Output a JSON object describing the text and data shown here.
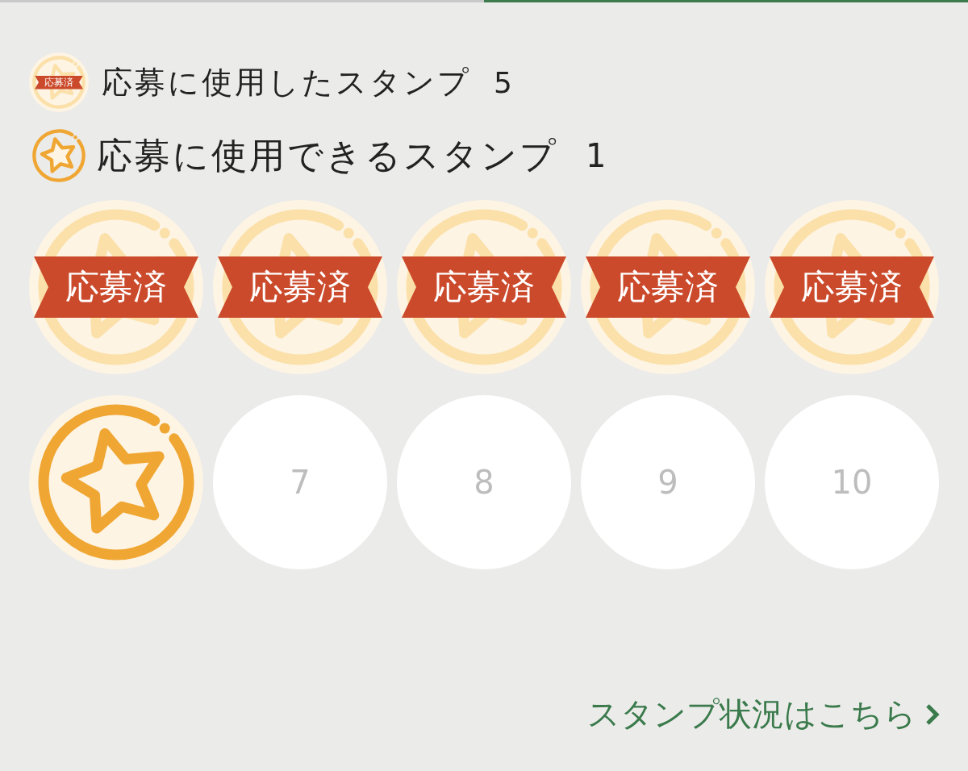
{
  "legend": [
    {
      "kind": "used",
      "badge": "応募済",
      "label": "応募に使用したスタンプ",
      "count": "5"
    },
    {
      "kind": "available",
      "label": "応募に使用できるスタンプ",
      "count": "1"
    }
  ],
  "stamps": [
    {
      "kind": "used",
      "badge": "応募済"
    },
    {
      "kind": "used",
      "badge": "応募済"
    },
    {
      "kind": "used",
      "badge": "応募済"
    },
    {
      "kind": "used",
      "badge": "応募済"
    },
    {
      "kind": "used",
      "badge": "応募済"
    },
    {
      "kind": "available"
    },
    {
      "kind": "empty",
      "number": "7"
    },
    {
      "kind": "empty",
      "number": "8"
    },
    {
      "kind": "empty",
      "number": "9"
    },
    {
      "kind": "empty",
      "number": "10"
    }
  ],
  "link": {
    "label": "スタンプ状況はこちら"
  }
}
